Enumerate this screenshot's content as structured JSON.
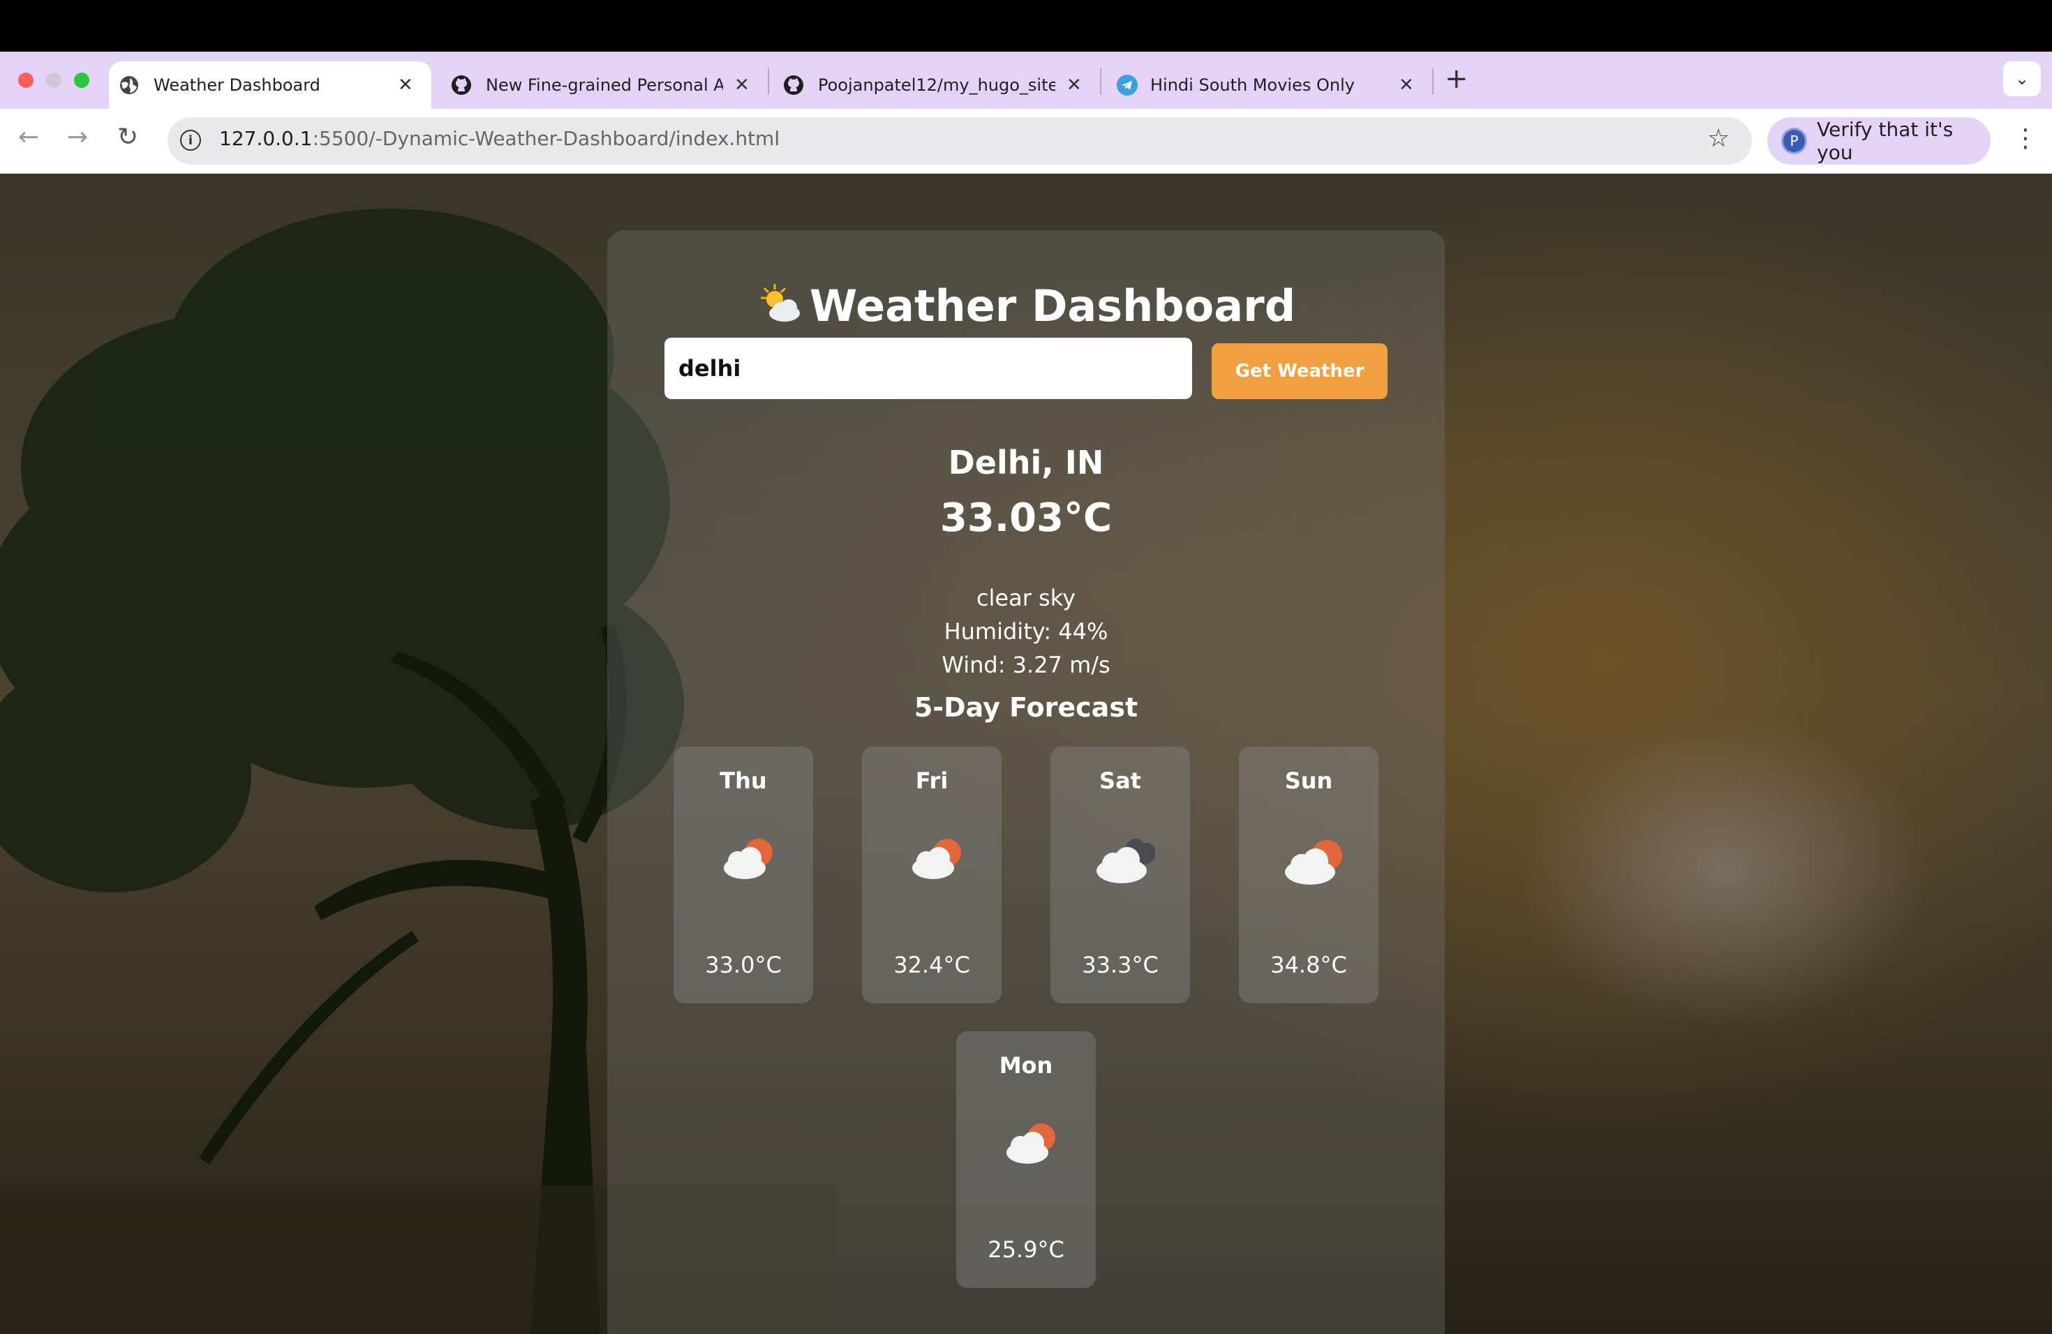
{
  "browser": {
    "tabs": [
      {
        "title": "Weather Dashboard",
        "active": true,
        "icon": "globe-icon"
      },
      {
        "title": "New Fine-grained Personal Ac",
        "active": false,
        "icon": "github-icon"
      },
      {
        "title": "Poojanpatel12/my_hugo_site",
        "active": false,
        "icon": "github-icon"
      },
      {
        "title": "Hindi South Movies Only",
        "active": false,
        "icon": "telegram-icon"
      }
    ],
    "url_host": "127.0.0.1",
    "url_path": ":5500/-Dynamic-Weather-Dashboard/index.html",
    "verify_label": "Verify that it's you",
    "verify_avatar": "P"
  },
  "dashboard": {
    "title": "Weather Dashboard",
    "search": {
      "value": "delhi"
    },
    "button_label": "Get Weather",
    "city": "Delhi, IN",
    "temperature": "33.03°C",
    "description": "clear sky",
    "humidity": "Humidity: 44%",
    "wind": "Wind: 3.27 m/s",
    "forecast_title": "5-Day Forecast",
    "forecast": [
      {
        "day": "Thu",
        "temp": "33.0°C",
        "icon": "rain-sun-icon"
      },
      {
        "day": "Fri",
        "temp": "32.4°C",
        "icon": "rain-sun-icon"
      },
      {
        "day": "Sat",
        "temp": "33.3°C",
        "icon": "cloudy-icon"
      },
      {
        "day": "Sun",
        "temp": "34.8°C",
        "icon": "partly-cloudy-icon"
      },
      {
        "day": "Mon",
        "temp": "25.9°C",
        "icon": "rain-sun-icon"
      }
    ]
  },
  "colors": {
    "accent": "#f0a040",
    "tabstrip": "#e3d4f7"
  }
}
